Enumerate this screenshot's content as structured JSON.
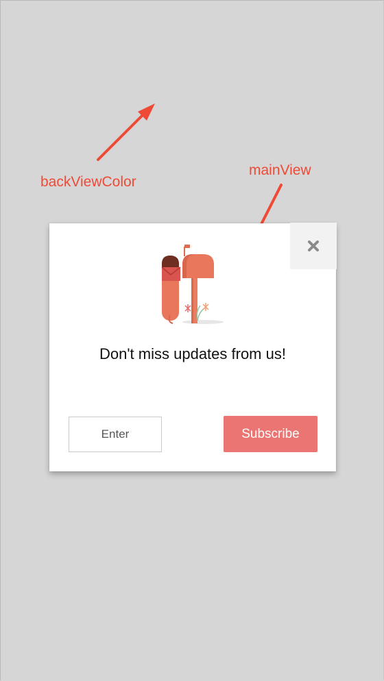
{
  "annotations": {
    "back_view_label": "backViewColor",
    "main_view_label": "mainView"
  },
  "dialog": {
    "headline": "Don't miss updates from us!",
    "email_placeholder": "Enter",
    "subscribe_label": "Subscribe",
    "close_icon": "close-icon",
    "illustration_icon": "mailbox-icon"
  },
  "colors": {
    "backdrop": "#d6d6d6",
    "annotation": "#ef4a35",
    "subscribe_button": "#ea7572",
    "dialog_background": "#ffffff"
  }
}
